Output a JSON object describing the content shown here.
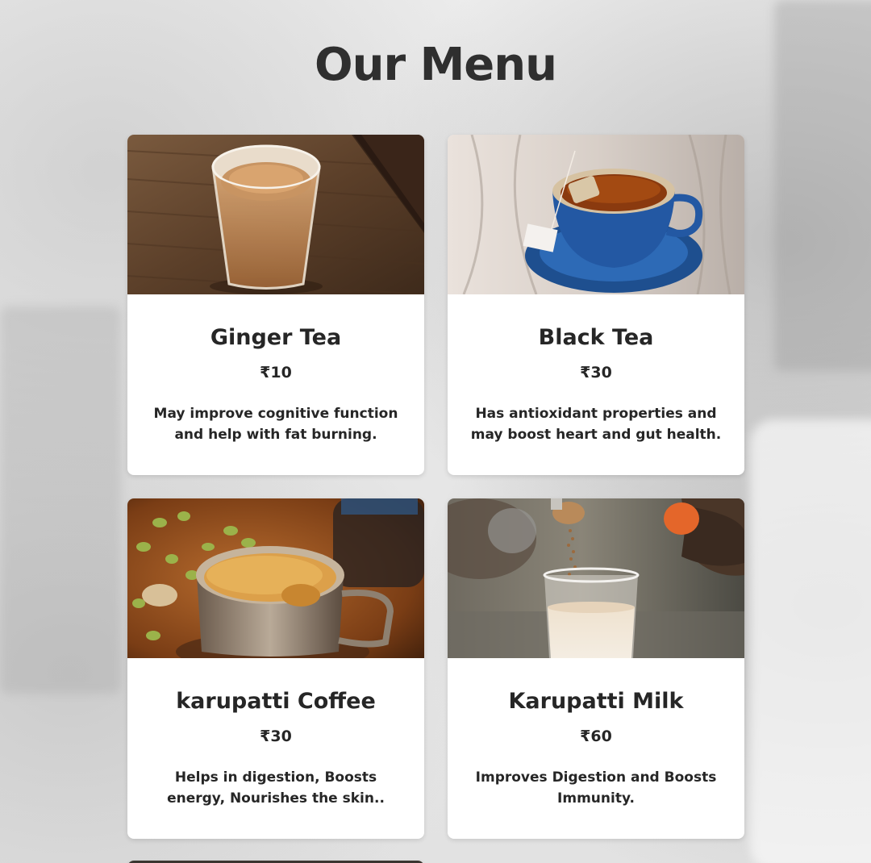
{
  "page": {
    "title": "Our Menu"
  },
  "menu": [
    {
      "name": "Ginger Tea",
      "price": "₹10",
      "description": "May improve cognitive function and help with fat burning.",
      "image_icon": "ginger-tea-glass-image"
    },
    {
      "name": "Black Tea",
      "price": "₹30",
      "description": "Has antioxidant properties and may boost heart and gut health.",
      "image_icon": "black-tea-cup-image"
    },
    {
      "name": "karupatti Coffee",
      "price": "₹30",
      "description": "Helps in digestion, Boosts energy, Nourishes the skin..",
      "image_icon": "karupatti-coffee-mug-image"
    },
    {
      "name": "Karupatti Milk",
      "price": "₹60",
      "description": "Improves Digestion and Boosts Immunity.",
      "image_icon": "karupatti-milk-glass-image"
    }
  ],
  "colors": {
    "heading": "#2f2f2f",
    "text": "#262626",
    "card_background": "#ffffff"
  }
}
